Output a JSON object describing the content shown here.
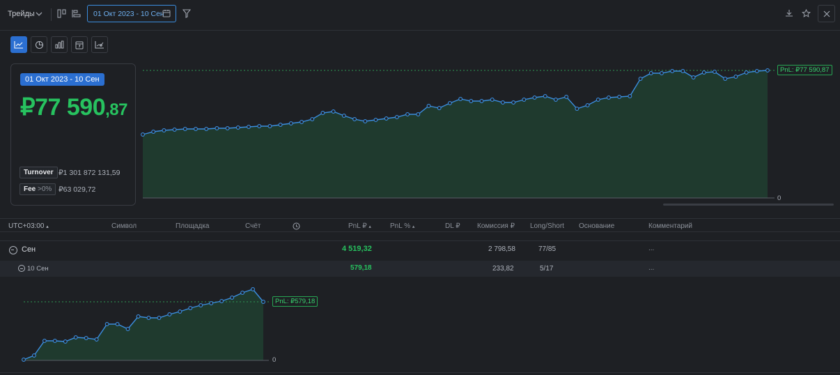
{
  "toolbar": {
    "trades_label": "Трейды",
    "date_range": "01 Окт 2023 - 10 Сен"
  },
  "card": {
    "range": "01 Окт 2023 - 10 Сен",
    "pnl_int": "₽77 590",
    "pnl_dec": ",87",
    "turnover_label": "Turnover",
    "turnover_value": "₽1 301 872 131,59",
    "fee_label": "Fee",
    "fee_pct": ">0%",
    "fee_value": "₽63 029,72"
  },
  "main_chart": {
    "pnl_label": "PnL: ₽77 590,87",
    "zero_label": "0"
  },
  "table": {
    "headers": {
      "time": "UTC+03:00",
      "symbol": "Символ",
      "venue": "Площадка",
      "account": "Счёт",
      "pnl": "PnL ₽",
      "pnl_pct": "PnL %",
      "dl": "DL ₽",
      "commission": "Комиссия ₽",
      "long_short": "Long/Short",
      "basis": "Основание",
      "comment": "Комментарий"
    },
    "rows": [
      {
        "label": "Сен",
        "pnl": "4 519,32",
        "commission": "2 798,58",
        "long_short": "77/85",
        "comment": "..."
      },
      {
        "label": "10 Сен",
        "pnl": "579,18",
        "commission": "233,82",
        "long_short": "5/17",
        "comment": "..."
      }
    ]
  },
  "day_chart": {
    "pnl_label": "PnL: ₽579,18",
    "zero_label": "0"
  },
  "colors": {
    "accent": "#2b6fd1",
    "positive": "#27c25f",
    "line": "#3b8ee0",
    "area": "#1f3a2e"
  },
  "icons": [
    "chevron-down-icon",
    "columns-icon",
    "align-icon",
    "calendar-icon",
    "filter-icon",
    "download-icon",
    "star-icon",
    "close-icon",
    "line-chart-icon",
    "pie-chart-icon",
    "bar-chart-icon",
    "calendar-day-icon",
    "scatter-icon",
    "clock-icon"
  ]
}
